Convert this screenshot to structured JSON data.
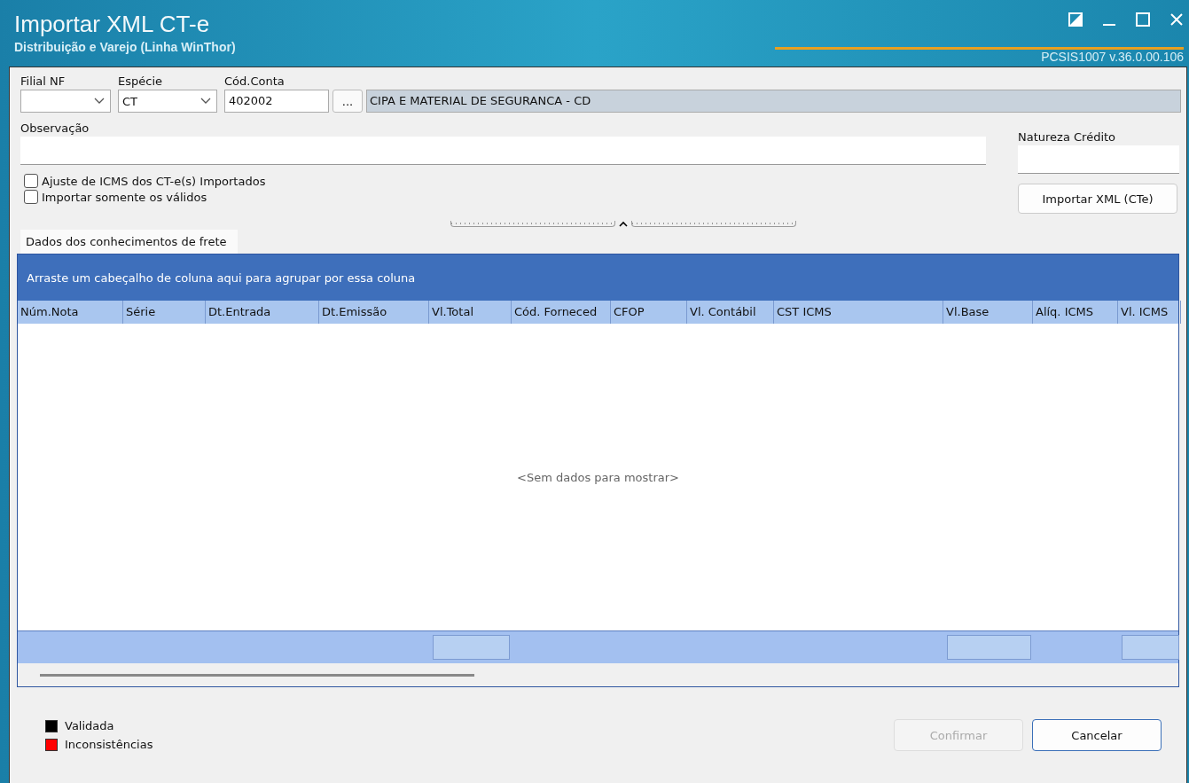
{
  "window": {
    "title": "Importar XML CT-e",
    "subtitle": "Distribuição e Varejo (Linha WinThor)",
    "version": "PCSIS1007  v.36.0.00.106"
  },
  "fields": {
    "filial": {
      "label": "Filial NF"
    },
    "especie": {
      "label": "Espécie",
      "value": "CT"
    },
    "conta": {
      "label": "Cód.Conta",
      "value": "402002",
      "browse": "...",
      "description": "CIPA E MATERIAL DE SEGURANCA - CD"
    },
    "observacao": {
      "label": "Observação"
    },
    "natureza": {
      "label": "Natureza Crédito"
    }
  },
  "checkboxes": [
    {
      "label": "Ajuste de ICMS dos CT-e(s) Importados",
      "checked": false
    },
    {
      "label": "Importar somente os válidos",
      "checked": false
    }
  ],
  "import_button": "Importar XML (CTe)",
  "tabs": [
    {
      "label": "Dados dos conhecimentos de frete",
      "selected": true
    }
  ],
  "grid": {
    "group_hint": "Arraste um cabeçalho de coluna aqui para agrupar por essa coluna",
    "empty_text": "<Sem dados para mostrar>",
    "columns": [
      {
        "label": "Núm.Nota",
        "summary": false
      },
      {
        "label": "Série",
        "summary": false
      },
      {
        "label": "Dt.Entrada",
        "summary": false
      },
      {
        "label": "Dt.Emissão",
        "summary": false
      },
      {
        "label": "Vl.Total",
        "summary": true
      },
      {
        "label": "Cód. Forneced",
        "summary": false
      },
      {
        "label": "CFOP",
        "summary": false
      },
      {
        "label": "Vl. Contábil",
        "summary": false
      },
      {
        "label": "CST ICMS",
        "summary": false
      },
      {
        "label": "Vl.Base",
        "summary": true
      },
      {
        "label": "Alíq. ICMS",
        "summary": false
      },
      {
        "label": "Vl. ICMS",
        "summary": true
      }
    ]
  },
  "legend": [
    {
      "label": "Validada",
      "color": "#000000"
    },
    {
      "label": "Inconsistências",
      "color": "#ff0000"
    }
  ],
  "buttons": [
    {
      "label": "Confirmar",
      "disabled": true
    },
    {
      "label": "Cancelar",
      "disabled": false
    }
  ]
}
